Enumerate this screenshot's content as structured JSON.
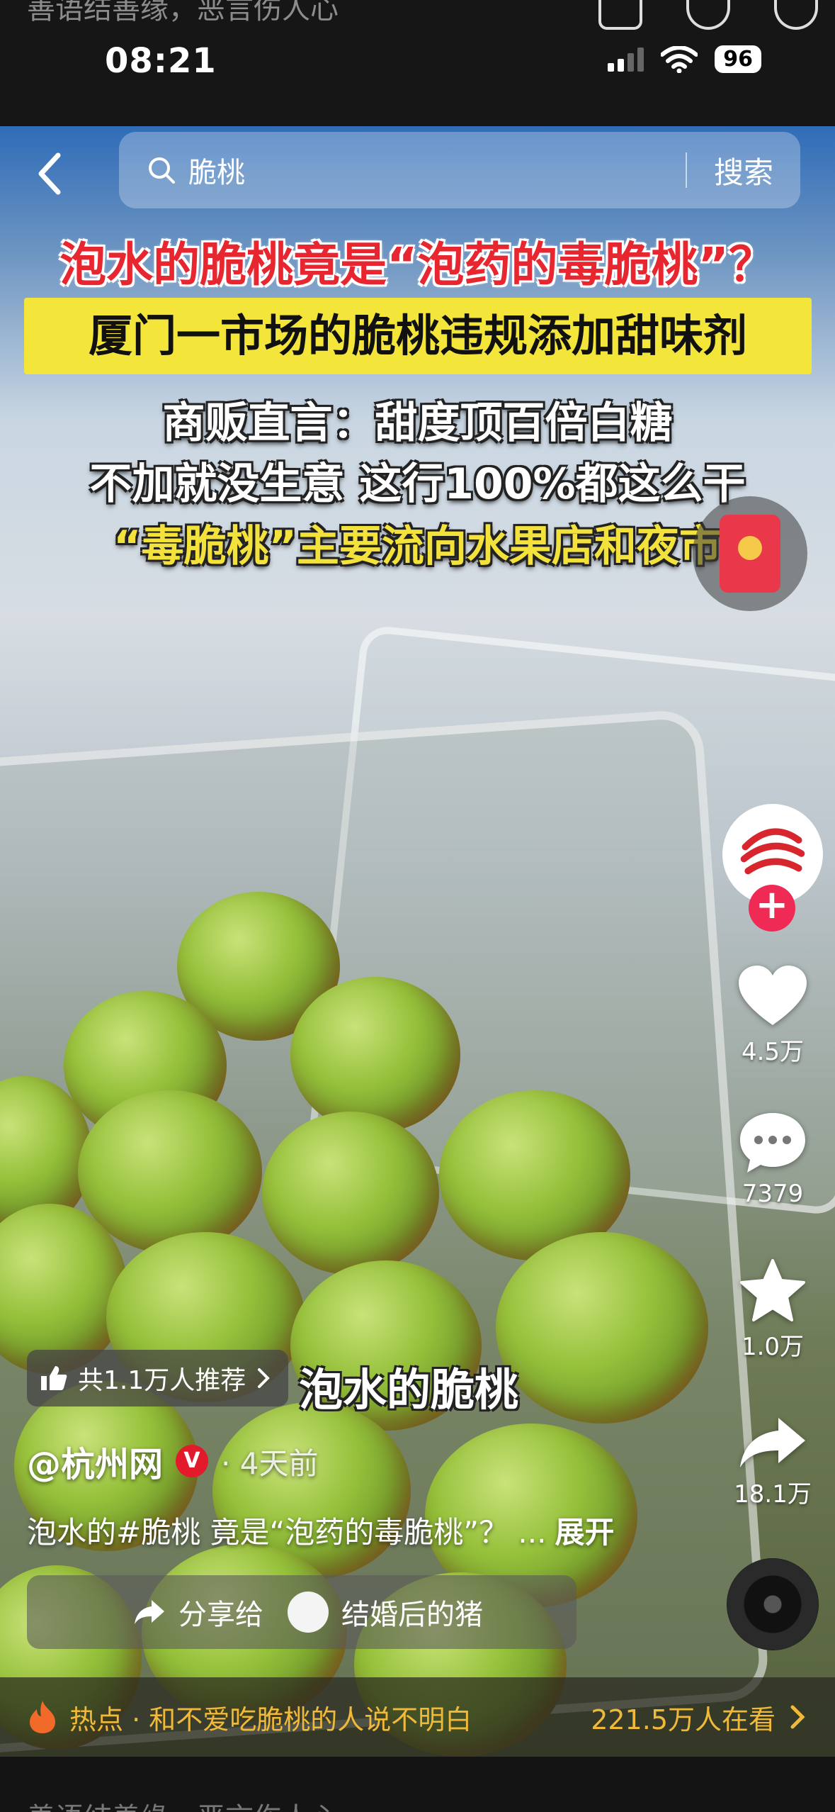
{
  "top_caption": "善语结善缘，恶言伤人心",
  "status": {
    "time": "08:21",
    "battery": "96"
  },
  "search": {
    "query": "脆桃",
    "button": "搜索"
  },
  "video_text": {
    "headline": "泡水的脆桃竟是“泡药的毒脆桃”？",
    "banner": "厦门一市场的脆桃违规添加甜味剂",
    "line1": "商贩直言：甜度顶百倍白糖",
    "line2": "不加就没生意 这行100%都这么干",
    "line3": "“毒脆桃”主要流向水果店和夜市",
    "subtitle": "泡水的脆桃"
  },
  "actions": {
    "likes": "4.5万",
    "comments": "7379",
    "favorites": "1.0万",
    "shares": "18.1万"
  },
  "recommend": {
    "label": "共1.1万人推荐"
  },
  "author": {
    "name": "@杭州网",
    "verified_badge": "V",
    "time": "· 4天前"
  },
  "description": {
    "text": "泡水的#脆桃 竟是“泡药的毒脆桃”？ ...",
    "expand": "展开"
  },
  "share": {
    "label": "分享给",
    "friend": "结婚后的猪"
  },
  "hot": {
    "text": "热点 · 和不爱吃脆桃的人说不明白",
    "count": "221.5万人在看"
  },
  "bottom_caption": "善语结善缘，恶言伤人心",
  "colors": {
    "hot_accent": "#f0b93a",
    "banner_yellow": "#f3e53a",
    "headline_red": "#e8262f",
    "follow_pink": "#ef2b55"
  }
}
